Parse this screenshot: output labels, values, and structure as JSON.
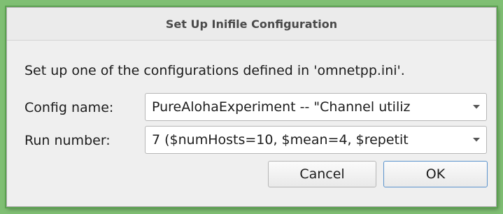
{
  "dialog": {
    "title": "Set Up Inifile Configuration",
    "description": "Set up one of the configurations defined in 'omnetpp.ini'.",
    "config_name": {
      "label": "Config name:",
      "value": "PureAlohaExperiment -- \"Channel utiliz"
    },
    "run_number": {
      "label": "Run number:",
      "value": "7 ($numHosts=10, $mean=4, $repetit"
    },
    "cancel_label": "Cancel",
    "ok_label": "OK"
  },
  "colors": {
    "background": "#7fbf73",
    "dialog_bg": "#efefef",
    "ok_border": "#5b93cc"
  },
  "icons": {
    "dropdown": "chevron-down-icon"
  }
}
